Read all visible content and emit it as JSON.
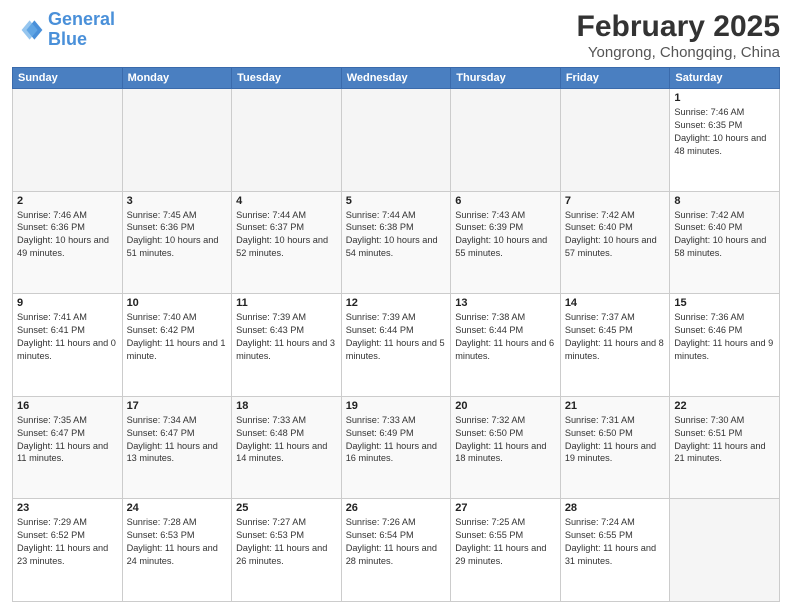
{
  "header": {
    "logo_line1": "General",
    "logo_line2": "Blue",
    "main_title": "February 2025",
    "sub_title": "Yongrong, Chongqing, China"
  },
  "weekdays": [
    "Sunday",
    "Monday",
    "Tuesday",
    "Wednesday",
    "Thursday",
    "Friday",
    "Saturday"
  ],
  "weeks": [
    [
      {
        "day": "",
        "info": ""
      },
      {
        "day": "",
        "info": ""
      },
      {
        "day": "",
        "info": ""
      },
      {
        "day": "",
        "info": ""
      },
      {
        "day": "",
        "info": ""
      },
      {
        "day": "",
        "info": ""
      },
      {
        "day": "1",
        "info": "Sunrise: 7:46 AM\nSunset: 6:35 PM\nDaylight: 10 hours and 48 minutes."
      }
    ],
    [
      {
        "day": "2",
        "info": "Sunrise: 7:46 AM\nSunset: 6:36 PM\nDaylight: 10 hours and 49 minutes."
      },
      {
        "day": "3",
        "info": "Sunrise: 7:45 AM\nSunset: 6:36 PM\nDaylight: 10 hours and 51 minutes."
      },
      {
        "day": "4",
        "info": "Sunrise: 7:44 AM\nSunset: 6:37 PM\nDaylight: 10 hours and 52 minutes."
      },
      {
        "day": "5",
        "info": "Sunrise: 7:44 AM\nSunset: 6:38 PM\nDaylight: 10 hours and 54 minutes."
      },
      {
        "day": "6",
        "info": "Sunrise: 7:43 AM\nSunset: 6:39 PM\nDaylight: 10 hours and 55 minutes."
      },
      {
        "day": "7",
        "info": "Sunrise: 7:42 AM\nSunset: 6:40 PM\nDaylight: 10 hours and 57 minutes."
      },
      {
        "day": "8",
        "info": "Sunrise: 7:42 AM\nSunset: 6:40 PM\nDaylight: 10 hours and 58 minutes."
      }
    ],
    [
      {
        "day": "9",
        "info": "Sunrise: 7:41 AM\nSunset: 6:41 PM\nDaylight: 11 hours and 0 minutes."
      },
      {
        "day": "10",
        "info": "Sunrise: 7:40 AM\nSunset: 6:42 PM\nDaylight: 11 hours and 1 minute."
      },
      {
        "day": "11",
        "info": "Sunrise: 7:39 AM\nSunset: 6:43 PM\nDaylight: 11 hours and 3 minutes."
      },
      {
        "day": "12",
        "info": "Sunrise: 7:39 AM\nSunset: 6:44 PM\nDaylight: 11 hours and 5 minutes."
      },
      {
        "day": "13",
        "info": "Sunrise: 7:38 AM\nSunset: 6:44 PM\nDaylight: 11 hours and 6 minutes."
      },
      {
        "day": "14",
        "info": "Sunrise: 7:37 AM\nSunset: 6:45 PM\nDaylight: 11 hours and 8 minutes."
      },
      {
        "day": "15",
        "info": "Sunrise: 7:36 AM\nSunset: 6:46 PM\nDaylight: 11 hours and 9 minutes."
      }
    ],
    [
      {
        "day": "16",
        "info": "Sunrise: 7:35 AM\nSunset: 6:47 PM\nDaylight: 11 hours and 11 minutes."
      },
      {
        "day": "17",
        "info": "Sunrise: 7:34 AM\nSunset: 6:47 PM\nDaylight: 11 hours and 13 minutes."
      },
      {
        "day": "18",
        "info": "Sunrise: 7:33 AM\nSunset: 6:48 PM\nDaylight: 11 hours and 14 minutes."
      },
      {
        "day": "19",
        "info": "Sunrise: 7:33 AM\nSunset: 6:49 PM\nDaylight: 11 hours and 16 minutes."
      },
      {
        "day": "20",
        "info": "Sunrise: 7:32 AM\nSunset: 6:50 PM\nDaylight: 11 hours and 18 minutes."
      },
      {
        "day": "21",
        "info": "Sunrise: 7:31 AM\nSunset: 6:50 PM\nDaylight: 11 hours and 19 minutes."
      },
      {
        "day": "22",
        "info": "Sunrise: 7:30 AM\nSunset: 6:51 PM\nDaylight: 11 hours and 21 minutes."
      }
    ],
    [
      {
        "day": "23",
        "info": "Sunrise: 7:29 AM\nSunset: 6:52 PM\nDaylight: 11 hours and 23 minutes."
      },
      {
        "day": "24",
        "info": "Sunrise: 7:28 AM\nSunset: 6:53 PM\nDaylight: 11 hours and 24 minutes."
      },
      {
        "day": "25",
        "info": "Sunrise: 7:27 AM\nSunset: 6:53 PM\nDaylight: 11 hours and 26 minutes."
      },
      {
        "day": "26",
        "info": "Sunrise: 7:26 AM\nSunset: 6:54 PM\nDaylight: 11 hours and 28 minutes."
      },
      {
        "day": "27",
        "info": "Sunrise: 7:25 AM\nSunset: 6:55 PM\nDaylight: 11 hours and 29 minutes."
      },
      {
        "day": "28",
        "info": "Sunrise: 7:24 AM\nSunset: 6:55 PM\nDaylight: 11 hours and 31 minutes."
      },
      {
        "day": "",
        "info": ""
      }
    ]
  ]
}
